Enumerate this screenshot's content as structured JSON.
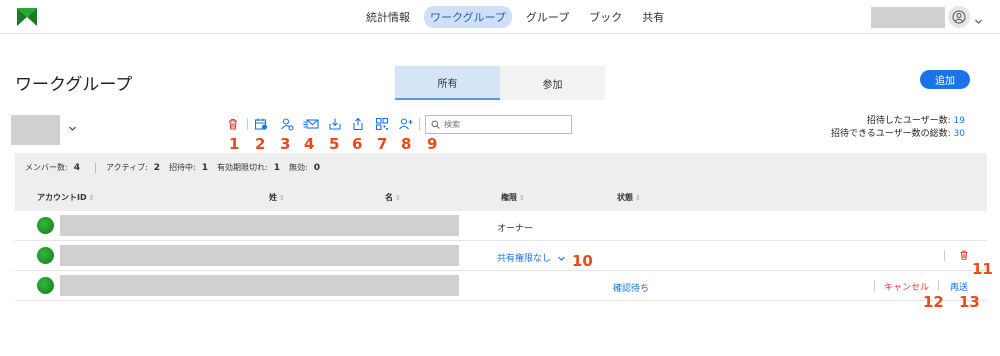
{
  "nav": {
    "items": [
      {
        "label": "統計情報",
        "active": false
      },
      {
        "label": "ワークグループ",
        "active": true
      },
      {
        "label": "グループ",
        "active": false
      },
      {
        "label": "ブック",
        "active": false
      },
      {
        "label": "共有",
        "active": false
      }
    ]
  },
  "page": {
    "title": "ワークグループ",
    "tabs": [
      {
        "label": "所有",
        "active": true
      },
      {
        "label": "参加",
        "active": false
      }
    ],
    "add_label": "追加"
  },
  "toolbar": {
    "numbers": [
      "1",
      "2",
      "3",
      "4",
      "5",
      "6",
      "7",
      "8",
      "9"
    ],
    "search_placeholder": "検索",
    "icons": [
      "trash-icon",
      "calendar-user-icon",
      "user-link-icon",
      "mail-list-icon",
      "download-icon",
      "upload-icon",
      "qr-code-icon",
      "add-user-icon",
      "search-icon"
    ]
  },
  "stats": {
    "invited_label": "招待したユーザー数:",
    "invited_value": "19",
    "capacity_label": "招待できるユーザー数の総数:",
    "capacity_value": "30"
  },
  "summary": {
    "members_label": "メンバー数:",
    "members_value": "4",
    "active_label": "アクティブ:",
    "active_value": "2",
    "inviting_label": "招待中:",
    "inviting_value": "1",
    "expired_label": "有効期限切れ:",
    "expired_value": "1",
    "invalid_label": "無効:",
    "invalid_value": "0"
  },
  "table": {
    "headers": {
      "account_id": "アカウントID",
      "last_name": "姓",
      "first_name": "名",
      "role": "権限",
      "status": "状態"
    },
    "rows": [
      {
        "role": "オーナー",
        "status": ""
      },
      {
        "role": "共有権限なし",
        "status": "",
        "callout": "10",
        "delete_callout": "11"
      },
      {
        "role": "",
        "status": "確認待ち",
        "cancel_label": "キャンセル",
        "resend_label": "再送",
        "cancel_callout": "12",
        "resend_callout": "13"
      }
    ]
  },
  "colors": {
    "accent": "#1a73e8",
    "callout": "#ea4a1a",
    "danger": "#e53935",
    "brand_green": "#1e9e2c"
  }
}
